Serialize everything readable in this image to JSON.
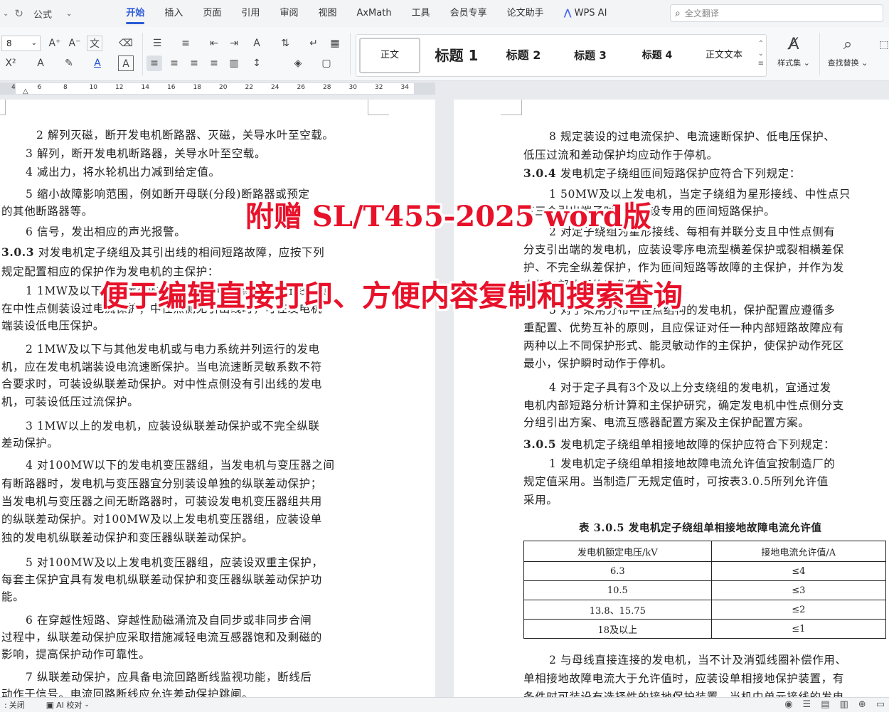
{
  "menubar": {
    "font_name": "公式",
    "tabs": [
      "开始",
      "插入",
      "页面",
      "引用",
      "审阅",
      "视图",
      "AxMath",
      "工具",
      "会员专享",
      "论文助手"
    ],
    "active_tab": "开始",
    "wps_ai": "WPS AI",
    "search_placeholder": "全文翻译"
  },
  "ribbon": {
    "font_size": "8",
    "styles": [
      "正文",
      "标题 1",
      "标题 2",
      "标题 3",
      "标题 4",
      "正文文本"
    ],
    "style_set_label": "样式集",
    "find_replace_label": "查找替换"
  },
  "ruler": {
    "ticks": [
      "4",
      "6",
      "8",
      "10",
      "12",
      "14",
      "16",
      "18",
      "20",
      "22",
      "24",
      "26",
      "28",
      "30",
      "32",
      "34"
    ]
  },
  "left_page": {
    "lines": [
      "2 解列灭磁，断开发电机断路器、灭磁，关导水叶至空载。",
      "3 解列，断开发电机断路器，关导水叶至空载。",
      "4 减出力，将水轮机出力减到给定值。",
      "5 缩小故障影响范围，例如断开母联(分段)断路器或预定",
      "的其他断路器等。",
      "6 信号，发出相应的声光报警。",
      "对发电机定子绕组及其引出线的相间短路故障，应按下列",
      "规定配置相应的保护作为发电机的主保护：",
      "1 1MW及以下单独运行的发电机，如中性点侧有引出线，则",
      "在中性点侧装设过电流保护；中性点侧无引出线时，可在发电机",
      "端装设低电压保护。",
      "2 1MW及以下与其他发电机或与电力系统并列运行的发电",
      "机，应在发电机端装设电流速断保护。当电流速断灵敏系数不符",
      "合要求时，可装设纵联差动保护。对中性点侧没有引出线的发电",
      "机，可装设低压过流保护。",
      "3 1MW以上的发电机，应装设纵联差动保护或不完全纵联",
      "差动保护。",
      "4 对100MW以下的发电机变压器组，当发电机与变压器之间",
      "有断路器时，发电机与变压器宜分别装设单独的纵联差动保护；",
      "当发电机与变压器之间无断路器时，可装设发电机变压器组共用",
      "的纵联差动保护。对100MW及以上发电机变压器组，应装设单",
      "独的发电机纵联差动保护和变压器纵联差动保护。",
      "5 对100MW及以上发电机变压器组，应装设双重主保护，",
      "每套主保护宜具有发电机纵联差动保护和变压器纵联差动保护功",
      "能。",
      "6 在穿越性短路、穿越性励磁涌流及自同步或非同步合闸",
      "过程中，纵联差动保护应采取措施减轻电流互感器饱和及剩磁的",
      "影响，提高保护动作可靠性。",
      "7 纵联差动保护，应具备电流回路断线监视功能，断线后",
      "动作于信号。电流回路断线应允许差动保护跳闸。"
    ],
    "clause_303": "3.0.3"
  },
  "right_page": {
    "lines": [
      "8 规定装设的过电流保护、电流速断保护、低电压保护、",
      "低压过流和差动保护均应动作于停机。",
      "发电机定子绕组匝间短路保护应符合下列规定：",
      "1 50MW及以上发电机，当定子绕组为星形接线、中性点只",
      "有三个引出端子时，宜装设专用的匝间短路保护。",
      "2 对定子绕组为星形接线、每相有并联分支且中性点侧有",
      "分支引出端的发电机，应装设零序电流型横差保护或裂相横差保",
      "护、不完全纵差保护，作为匝间短路等故障的主保护，并作为发",
      "电机内部故障的后备保护。",
      "3 对于采用分布中性点结构的发电机，保护配置应遵循多",
      "重配置、优势互补的原则，且应保证对任一种内部短路故障应有",
      "两种以上不同保护形式、能灵敏动作的主保护，使保护动作死区",
      "最小，保护瞬时动作于停机。",
      "4 对于定子具有3个及以上分支绕组的发电机，宜通过发",
      "电机内部短路分析计算和主保护研究，确定发电机中性点侧分支",
      "分组引出方案、电流互感器配置方案及主保护配置方案。",
      "发电机定子绕组单相接地故障的保护应符合下列规定：",
      "1 发电机定子绕组单相接地故障电流允许值宜按制造厂的",
      "规定值采用。当制造厂无规定值时，可按表3.0.5所列允许值",
      "采用。",
      "2 与母线直接连接的发电机，当不计及消弧线圈补偿作用、",
      "单相接地故障电流大于允许值时，应装设单相接地保护装置，有",
      "条件时可装设有选择性的接地保护装置，当机中单元接线的发电"
    ],
    "clause_304": "3.0.4",
    "clause_305": "3.0.5",
    "table_title": "表 3.0.5  发电机定子绕组单相接地故障电流允许值",
    "table_headers": [
      "发电机额定电压/kV",
      "接地电流允许值/A"
    ],
    "table_rows": [
      [
        "6.3",
        "≤4"
      ],
      [
        "10.5",
        "≤3"
      ],
      [
        "13.8、15.75",
        "≤2"
      ],
      [
        "18及以上",
        "≤1"
      ]
    ]
  },
  "overlay": {
    "banner1": "附赠 SL/T455-2025 word版",
    "banner2": "便于编辑直接打印、方便内容复制和搜索查询"
  },
  "statusbar": {
    "item1": "关闭",
    "item2": "AI 校对"
  },
  "colors": {
    "accent": "#2a5bd7",
    "banner_red": "#e8112a"
  }
}
